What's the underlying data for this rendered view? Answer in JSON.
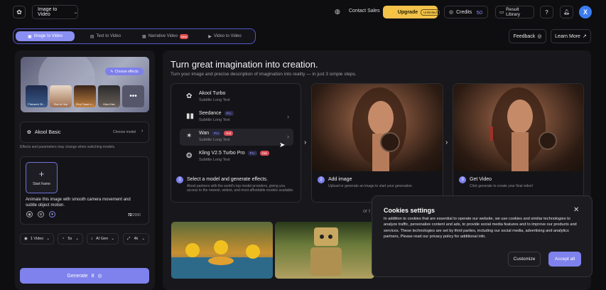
{
  "header": {
    "mode_select": "Image to Video",
    "contact": "Contact Sales",
    "upgrade": "Upgrade",
    "upgrade_badge": "Unlimited",
    "credits_label": "Credits",
    "credits_value": "50",
    "library": "Result Library",
    "avatar_initial": "X"
  },
  "tabs": [
    {
      "label": "Image to Video",
      "icon": "image-icon",
      "badge": ""
    },
    {
      "label": "Text to Video",
      "icon": "text-icon",
      "badge": ""
    },
    {
      "label": "Narrative Video",
      "icon": "film-icon",
      "badge": "New"
    },
    {
      "label": "Video to Video",
      "icon": "video-icon",
      "badge": ""
    }
  ],
  "actions": {
    "feedback": "Feedback",
    "learn_more": "Learn More"
  },
  "left": {
    "choose_effects": "Choose effects",
    "effects": [
      "Firework 20...",
      "Box of Joy",
      "First Toast o...",
      "Kiss Kiss"
    ],
    "model_name": "Akool Basic",
    "choose_model": "Choose model",
    "note": "Effects and parameters may change when switching models.",
    "start_frame": "Start frame",
    "prompt": "Animate this image with smooth camera movement and subtle object motion.",
    "char_count": "72",
    "char_max": "/2000",
    "options": [
      "1 Video",
      "5s",
      "AI Gen",
      "4k"
    ],
    "generate": "Generate",
    "generate_cost": "8"
  },
  "main": {
    "title": "Turn great imagination into creation.",
    "subtitle": "Turn your image and precise description of imagination into reality — in just 3 simple steps.",
    "models": [
      {
        "name": "Akool Turbo",
        "sub": "Subtitle Long Text",
        "pro": "",
        "hot": ""
      },
      {
        "name": "Seedance",
        "sub": "Subtitle Long Text",
        "pro": "Pro",
        "hot": ""
      },
      {
        "name": "Wan",
        "sub": "Subtitle Long Text",
        "pro": "Pro",
        "hot": "Hot"
      },
      {
        "name": "Kling V2.5 Turbo Pro",
        "sub": "Subtitle Long Text",
        "pro": "Pro",
        "hot": "Hot"
      }
    ],
    "steps": [
      {
        "num": "1",
        "title": "Select a model and generate effects.",
        "desc": "Akool partners with the world's top model providers, giving you access to the newest, widest, and most affordable models available."
      },
      {
        "num": "2",
        "title": "Add image",
        "desc": "Upload or generate an image to start your generation."
      },
      {
        "num": "3",
        "title": "Get Video",
        "desc": "Click generate to create your final video!"
      }
    ],
    "or_text": "or t"
  },
  "cookie": {
    "title": "Cookies settings",
    "text": "In addition to cookies that are essential to operate our website, we use cookies and similar technologies to analyze traffic, personalize content and ads, to provide social media features and to improve our products and services. These technologies are set by third parties, including our social media, advertising and analytics partners, Please read our privacy policy for additional info.",
    "customize": "Customize",
    "accept": "Accept all"
  }
}
